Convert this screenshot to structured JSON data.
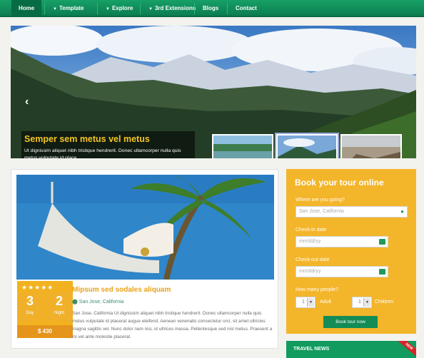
{
  "nav": {
    "items": [
      {
        "label": "Home",
        "caret": false
      },
      {
        "label": "Template",
        "caret": true
      },
      {
        "label": "Explore",
        "caret": true
      },
      {
        "label": "3rd Extensions",
        "caret": true
      },
      {
        "label": "Blogs",
        "caret": false
      },
      {
        "label": "Contact",
        "caret": false
      }
    ]
  },
  "slider": {
    "title": "Semper sem metus vel metus",
    "text": "Ut dignissim aliquet nibh tristique hendrerit. Donec ullamcorper nulla quis metus vulputate id place"
  },
  "tour": {
    "rating": "★★★★★",
    "days": {
      "value": "3",
      "label": "Day"
    },
    "nights": {
      "value": "2",
      "label": "Night"
    },
    "price": "$ 430",
    "title": "Mipsum sed sodales aliquam",
    "location": "San Jose, California",
    "description": "San Jose, California Ut dignissim aliquet nibh tristique hendrerit. Donec ullamcorper nulla quis metus vulputate id placerat augue eleifend. Aenean venenatis consectetur orci, sit amet ultricies magna sagittis vel. Nunc dolor nam nisi, ut ultrices massa. Pellentesque sed nisl metus. Praesent a mi vel ante molestie placerat."
  },
  "booking": {
    "title": "Book your tour online",
    "where_label": "Where are you going?",
    "where_placeholder": "San Jose, California",
    "checkin_label": "Check-in date",
    "checkin_placeholder": "mm/dd/yy",
    "checkout_label": "Check-out date",
    "checkout_placeholder": "mm/dd/yy",
    "people_label": "How many people?",
    "adult_value": "1",
    "adult_label": "Adult",
    "children_value": "1",
    "children_label": "Children",
    "button": "Book tour now"
  },
  "news": {
    "title": "TRAVEL NEWS",
    "ribbon": "NEW"
  },
  "colors": {
    "nav": "#0e8a58",
    "accent": "#f3b52a",
    "button": "#138c56"
  }
}
